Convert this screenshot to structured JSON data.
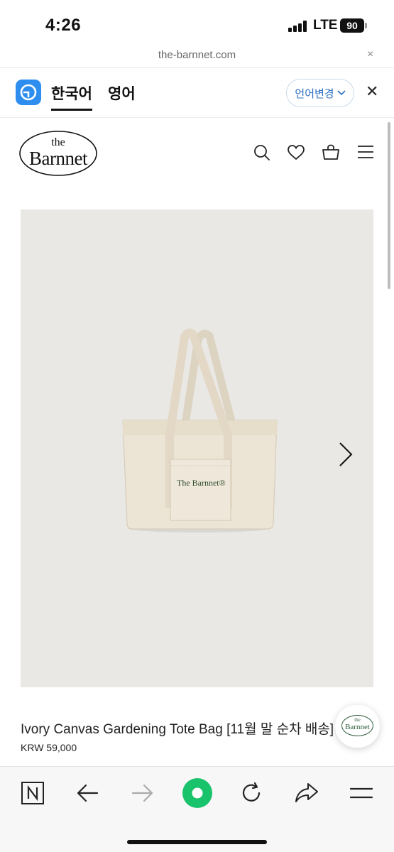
{
  "status_bar": {
    "time": "4:26",
    "network": "LTE",
    "battery": "90"
  },
  "browser": {
    "url": "the-barnnet.com",
    "close_glyph": "×"
  },
  "translation_bar": {
    "active_tab": "한국어",
    "other_tab": "영어",
    "change_language_label": "언어변경",
    "close_glyph": "✕"
  },
  "site": {
    "logo_small": "the",
    "logo_big": "Barnnet",
    "header_icons": [
      "search-icon",
      "heart-icon",
      "shopping-bag-icon",
      "menu-icon"
    ]
  },
  "product": {
    "bag_print": "The Barnnet®",
    "title": "Ivory Canvas Gardening Tote Bag [11월 말 순차 배송]",
    "price": "KRW 59,000"
  },
  "floating_button": {
    "logo_small": "the",
    "logo_big": "Barnnet"
  },
  "bottom_bar": {
    "icons": [
      "naver-icon",
      "back-arrow-icon",
      "forward-arrow-icon",
      "green-home-icon",
      "reload-icon",
      "share-icon",
      "menu-icon"
    ]
  },
  "colors": {
    "accent_blue": "#2d8ef0",
    "green_button": "#19c36b",
    "image_bg": "#e9e8e5",
    "logo_green": "#2c5b3a"
  }
}
